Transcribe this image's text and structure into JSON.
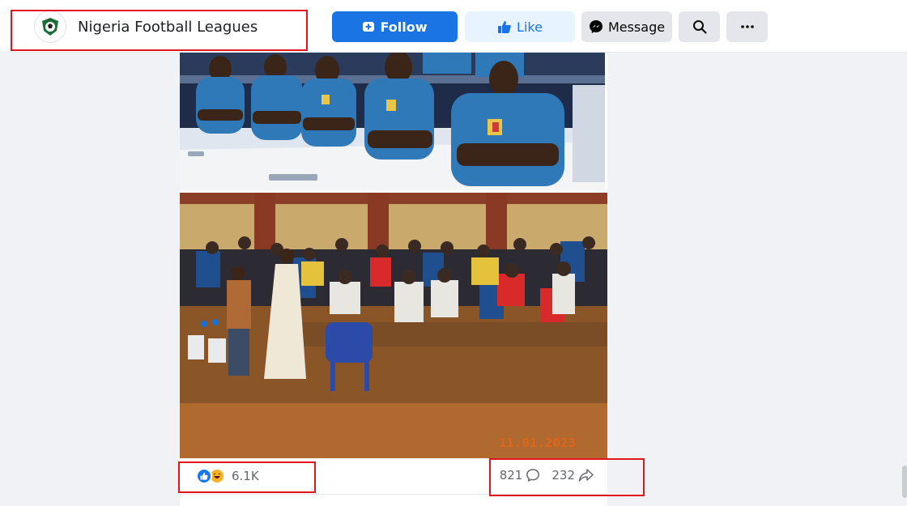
{
  "header": {
    "page_name": "Nigeria Football Leagues",
    "logo_icon": "football-crest-icon",
    "buttons": {
      "follow": "Follow",
      "like": "Like",
      "message": "Message"
    },
    "icons": {
      "follow": "follow-page-icon",
      "like": "thumbs-up-icon",
      "message": "messenger-icon",
      "search": "search-icon",
      "more": "more-options-icon"
    },
    "colors": {
      "primary": "#1b74e4",
      "like_bg": "#e7f3ff",
      "neutral_btn": "#e4e6eb"
    }
  },
  "post": {
    "photo_stamp": "11.01.2023",
    "reactions": {
      "icons": [
        "like-reaction-icon",
        "haha-reaction-icon"
      ],
      "count": "6.1K"
    },
    "comments": {
      "count": "821",
      "icon": "comment-icon"
    },
    "shares": {
      "count": "232",
      "icon": "share-icon"
    }
  },
  "annotations": {
    "highlight_color": "#e0161b"
  }
}
